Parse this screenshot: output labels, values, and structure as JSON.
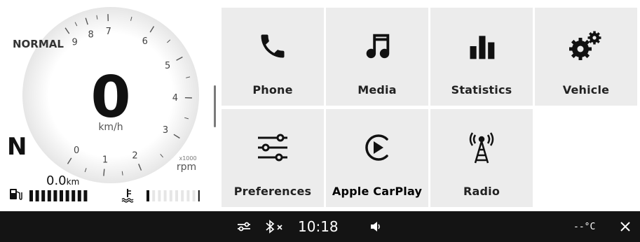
{
  "cluster": {
    "drive_mode": "NORMAL",
    "speed": "0",
    "speed_unit": "km/h",
    "gear": "N",
    "tach_multiplier": "x1000",
    "tach_unit": "rpm",
    "tach_labels": [
      "0",
      "1",
      "2",
      "3",
      "4",
      "5",
      "6",
      "7",
      "8",
      "9"
    ],
    "odometer_value": "0.0",
    "odometer_unit": "km",
    "fuel_level_fraction": 1.0,
    "coolant_level_fraction": 0.15
  },
  "apps": [
    {
      "label": "Phone",
      "icon": "phone-icon"
    },
    {
      "label": "Media",
      "icon": "music-note-icon"
    },
    {
      "label": "Statistics",
      "icon": "bar-chart-icon"
    },
    {
      "label": "Vehicle",
      "icon": "gears-icon"
    },
    {
      "label": "Preferences",
      "icon": "sliders-icon"
    },
    {
      "label": "Apple CarPlay",
      "icon": "carplay-icon"
    },
    {
      "label": "Radio",
      "icon": "radio-tower-icon"
    }
  ],
  "status_bar": {
    "time": "10:18",
    "temperature": "--°C",
    "icons": [
      "sliders-icon",
      "bluetooth-off-icon",
      "volume-icon",
      "close-icon"
    ]
  },
  "colors": {
    "tile_bg": "#ececec",
    "bar_bg": "#141414",
    "text": "#222222"
  }
}
